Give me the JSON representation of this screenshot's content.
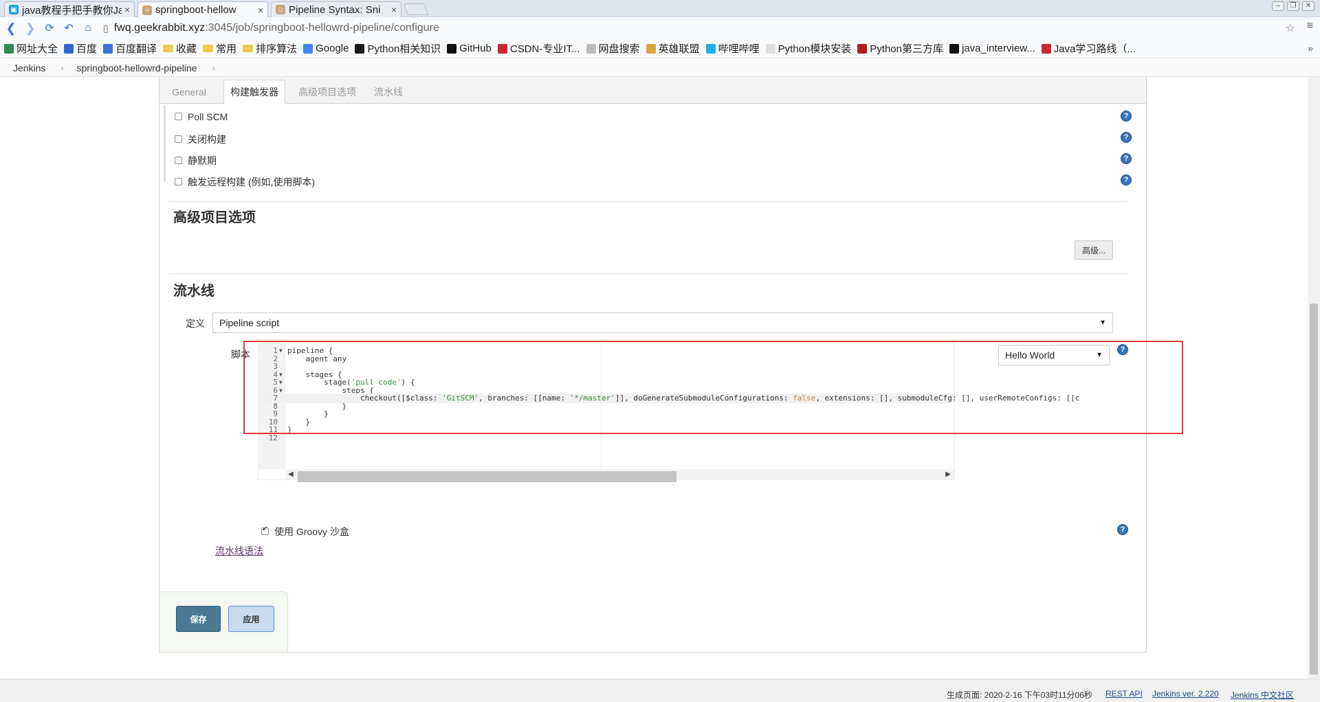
{
  "browser": {
    "tabs": [
      {
        "label": "java教程手把手教你JavaS",
        "active": false
      },
      {
        "label": "springboot-hellow",
        "active": true
      },
      {
        "label": "Pipeline Syntax: Sni",
        "active": false
      }
    ],
    "url_host": "fwq.geekrabbit.xyz",
    "url_path": ":3045/job/springboot-hellowrd-pipeline/configure",
    "bookmarks": [
      {
        "label": "网址大全",
        "icon": "grid-icon",
        "color": "#2e8b57"
      },
      {
        "label": "百度",
        "icon": "paw-icon",
        "color": "#3366cc"
      },
      {
        "label": "百度翻译",
        "icon": "translate-icon",
        "color": "#3b73d9"
      },
      {
        "label": "收藏",
        "icon": "folder-icon"
      },
      {
        "label": "常用",
        "icon": "folder-icon"
      },
      {
        "label": "排序算法",
        "icon": "folder-icon"
      },
      {
        "label": "Google",
        "icon": "google-icon",
        "color": "#4285f4"
      },
      {
        "label": "Python相关知识",
        "icon": "pycharm-icon",
        "color": "#1a1a1a"
      },
      {
        "label": "GitHub",
        "icon": "github-icon",
        "color": "#111111"
      },
      {
        "label": "CSDN-专业IT...",
        "icon": "csdn-icon",
        "color": "#c9282d"
      },
      {
        "label": "网盘搜索",
        "icon": "page-icon",
        "color": "#bbbbbb"
      },
      {
        "label": "英雄联盟",
        "icon": "lol-icon",
        "color": "#d9a441"
      },
      {
        "label": "哔哩哔哩",
        "icon": "bilibili-icon",
        "color": "#23ade5"
      },
      {
        "label": "Python模块安装",
        "icon": "page-icon",
        "color": "#dddddd"
      },
      {
        "label": "Python第三方库",
        "icon": "python-icon",
        "color": "#b01d1d"
      },
      {
        "label": "java_interview...",
        "icon": "github-icon",
        "color": "#111111"
      },
      {
        "label": "Java学习路线（...",
        "icon": "csdn-icon",
        "color": "#c9282d"
      }
    ]
  },
  "breadcrumb": {
    "root": "Jenkins",
    "job": "springboot-hellowrd-pipeline"
  },
  "config_tabs": [
    "General",
    "构建触发器",
    "高级项目选项",
    "流水线"
  ],
  "active_tab": "构建触发器",
  "triggers": [
    {
      "label": "Poll SCM",
      "checked": false
    },
    {
      "label": "关闭构建",
      "checked": false
    },
    {
      "label": "静默期",
      "checked": false
    },
    {
      "label": "触发远程构建 (例如,使用脚本)",
      "checked": false
    }
  ],
  "advanced_section": {
    "title": "高级项目选项",
    "advanced_button": "高级..."
  },
  "pipeline_section": {
    "title": "流水线",
    "definition_label": "定义",
    "definition_value": "Pipeline script",
    "script_label": "脚本",
    "sample_select": "Hello World",
    "groovy_sandbox_label": "使用 Groovy 沙盒",
    "groovy_sandbox_checked": true,
    "syntax_link": "流水线语法"
  },
  "script_lines": [
    {
      "n": "1",
      "fold": true,
      "segments": [
        {
          "t": "pipeline {"
        }
      ]
    },
    {
      "n": "2",
      "fold": false,
      "segments": [
        {
          "t": "    agent any"
        }
      ]
    },
    {
      "n": "3",
      "fold": false,
      "segments": [
        {
          "t": ""
        }
      ]
    },
    {
      "n": "4",
      "fold": true,
      "segments": [
        {
          "t": "    stages {"
        }
      ]
    },
    {
      "n": "5",
      "fold": true,
      "segments": [
        {
          "t": "        stage("
        },
        {
          "t": "'pull code'",
          "c": "str"
        },
        {
          "t": ") {"
        }
      ]
    },
    {
      "n": "6",
      "fold": true,
      "segments": [
        {
          "t": "            steps {"
        }
      ]
    },
    {
      "n": "7",
      "fold": false,
      "highlight": true,
      "segments": [
        {
          "t": "                checkout([$class: "
        },
        {
          "t": "'GitSCM'",
          "c": "str"
        },
        {
          "t": ", branches: [[name: "
        },
        {
          "t": "'*/master'",
          "c": "str"
        },
        {
          "t": "]], doGenerateSubmoduleConfigurations: "
        },
        {
          "t": "false",
          "c": "bool"
        },
        {
          "t": ", extensions: [], submoduleCfg: [], userRemoteConfigs: [[c"
        }
      ]
    },
    {
      "n": "8",
      "fold": false,
      "segments": [
        {
          "t": "            }"
        }
      ]
    },
    {
      "n": "9",
      "fold": false,
      "segments": [
        {
          "t": "        }"
        }
      ]
    },
    {
      "n": "10",
      "fold": false,
      "segments": [
        {
          "t": "    }"
        }
      ]
    },
    {
      "n": "11",
      "fold": false,
      "segments": [
        {
          "t": "}"
        }
      ]
    },
    {
      "n": "12",
      "fold": false,
      "segments": [
        {
          "t": ""
        }
      ]
    }
  ],
  "buttons": {
    "save": "保存",
    "apply": "应用"
  },
  "footer": {
    "generated": "生成页面: 2020-2-16 下午03时11分06秒",
    "rest_api": "REST API",
    "version": "Jenkins ver. 2.220",
    "community": "Jenkins 中文社区"
  },
  "colors": {
    "annotation_box": "#e03b3b",
    "save_button": "#4a7a94",
    "help_icon": "#3a72b8"
  }
}
